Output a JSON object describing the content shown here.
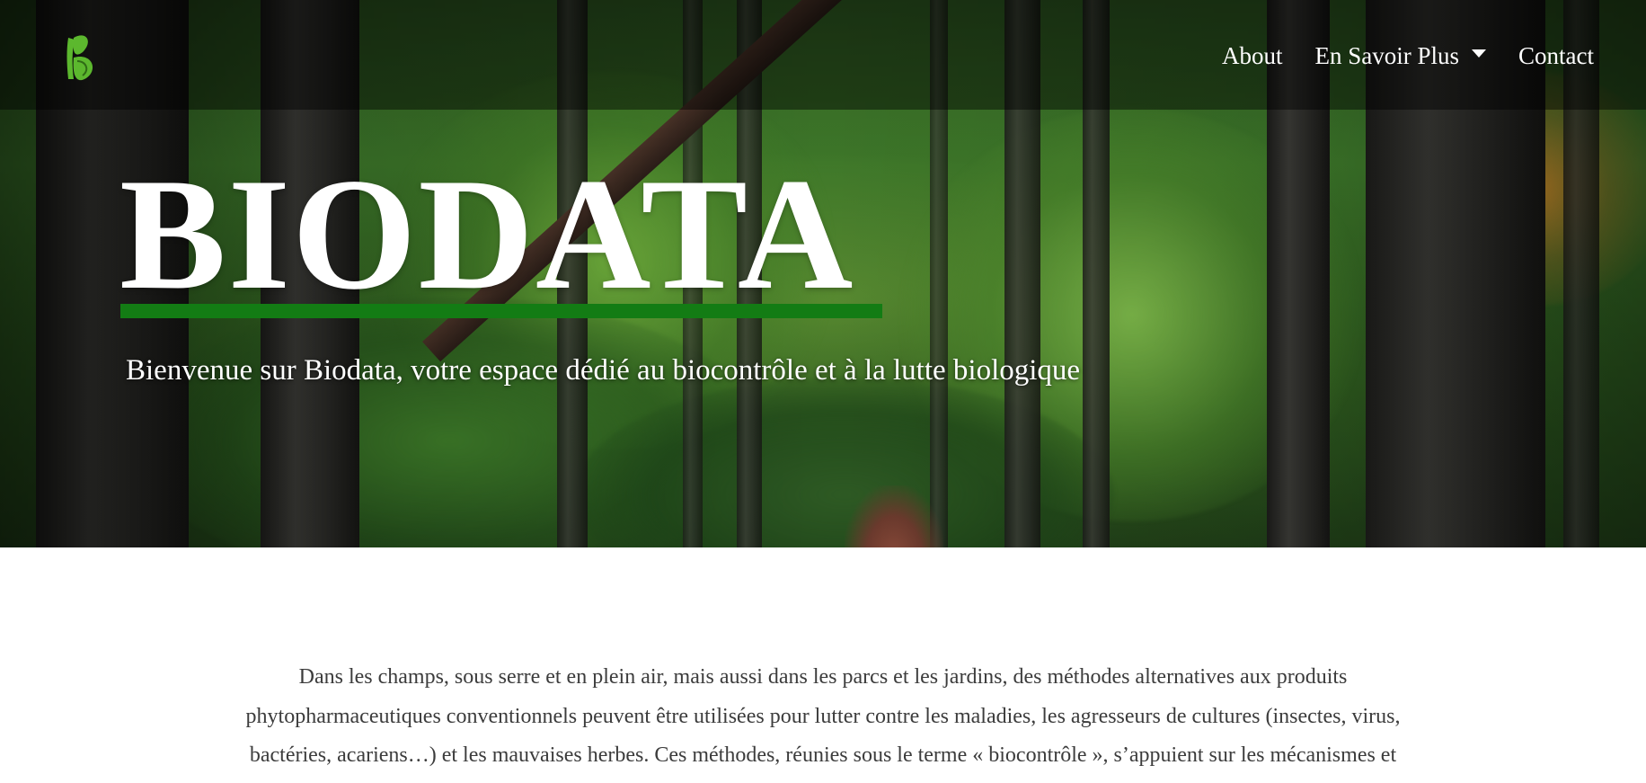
{
  "nav": {
    "logo_icon": "biodata-leaf-b-logo",
    "links": [
      {
        "label": "About"
      },
      {
        "label": "En Savoir Plus",
        "icon": "caret-down-icon"
      },
      {
        "label": "Contact"
      }
    ]
  },
  "hero": {
    "title": "BIODATA",
    "subtitle": "Bienvenue sur Biodata, votre espace dédié au biocontrôle et à la lutte biologique"
  },
  "intro": {
    "text": "Dans les champs, sous serre et en plein air, mais aussi dans les parcs et les jardins, des méthodes alternatives aux produits phytopharmaceutiques conventionnels peuvent être utilisées pour lutter contre les maladies, les agresseurs de cultures (insectes, virus, bactéries, acariens…) et les mauvaises herbes. Ces méthodes, réunies sous le terme « biocontrôle », s’appuient sur les mécanismes et interactions existant dans la nature."
  },
  "colors": {
    "accent_green": "#137c14",
    "logo_green": "#5cb82e",
    "body_text": "#3c3c3c"
  }
}
